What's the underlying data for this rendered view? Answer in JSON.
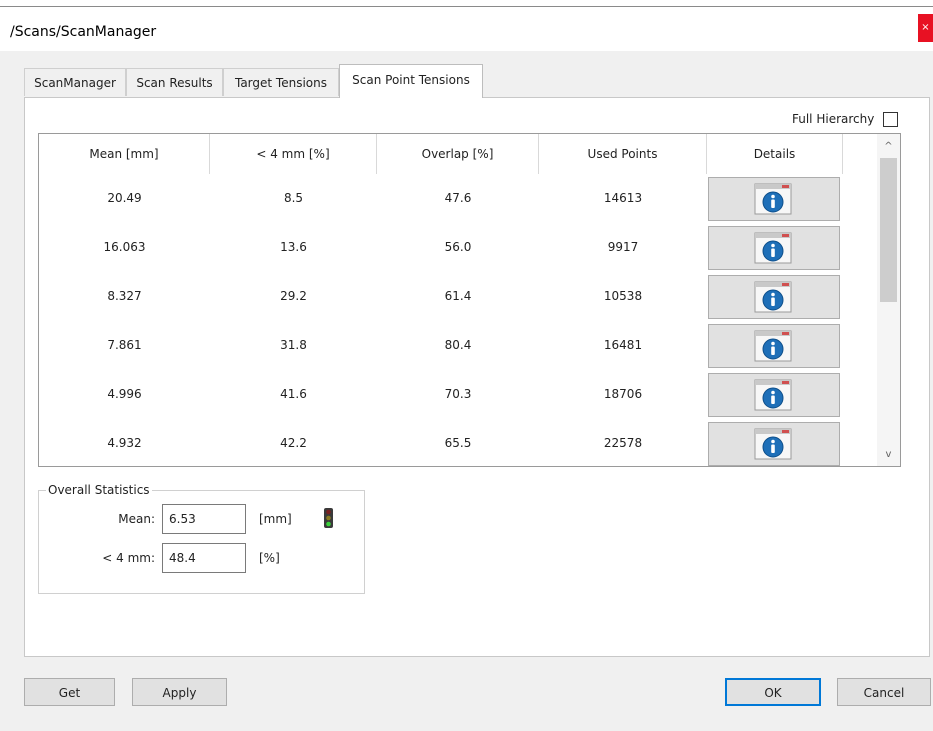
{
  "window": {
    "title": "/Scans/ScanManager",
    "close_glyph": "×"
  },
  "tabs": [
    {
      "label": "ScanManager",
      "active": false
    },
    {
      "label": "Scan Results",
      "active": false
    },
    {
      "label": "Target Tensions",
      "active": false
    },
    {
      "label": "Scan Point Tensions",
      "active": true
    }
  ],
  "full_hierarchy": {
    "label": "Full Hierarchy",
    "checked": false
  },
  "table": {
    "columns": [
      "Mean [mm]",
      "< 4 mm [%]",
      "Overlap [%]",
      "Used Points",
      "Details"
    ],
    "rows": [
      {
        "mean": "20.49",
        "under4": "8.5",
        "overlap": "47.6",
        "used_points": "14613"
      },
      {
        "mean": "16.063",
        "under4": "13.6",
        "overlap": "56.0",
        "used_points": "9917"
      },
      {
        "mean": "8.327",
        "under4": "29.2",
        "overlap": "61.4",
        "used_points": "10538"
      },
      {
        "mean": "7.861",
        "under4": "31.8",
        "overlap": "80.4",
        "used_points": "16481"
      },
      {
        "mean": "4.996",
        "under4": "41.6",
        "overlap": "70.3",
        "used_points": "18706"
      },
      {
        "mean": "4.932",
        "under4": "42.2",
        "overlap": "65.5",
        "used_points": "22578"
      }
    ],
    "details_icon": "info-icon",
    "scroll_up_glyph": "^",
    "scroll_down_glyph": "v"
  },
  "overall_statistics": {
    "title": "Overall Statistics",
    "mean_label": "Mean:",
    "mean_value": "6.53",
    "mean_unit": "[mm]",
    "under4_label": "< 4 mm:",
    "under4_value": "48.4",
    "under4_unit": "[%]",
    "status_icon": "traffic-light-icon"
  },
  "buttons": {
    "get": "Get",
    "apply": "Apply",
    "ok": "OK",
    "cancel": "Cancel"
  },
  "colors": {
    "close_red": "#e81123",
    "dialog_bg": "#f0f0f0",
    "info_blue": "#1e6fb8",
    "default_button_border": "#0078d7"
  }
}
